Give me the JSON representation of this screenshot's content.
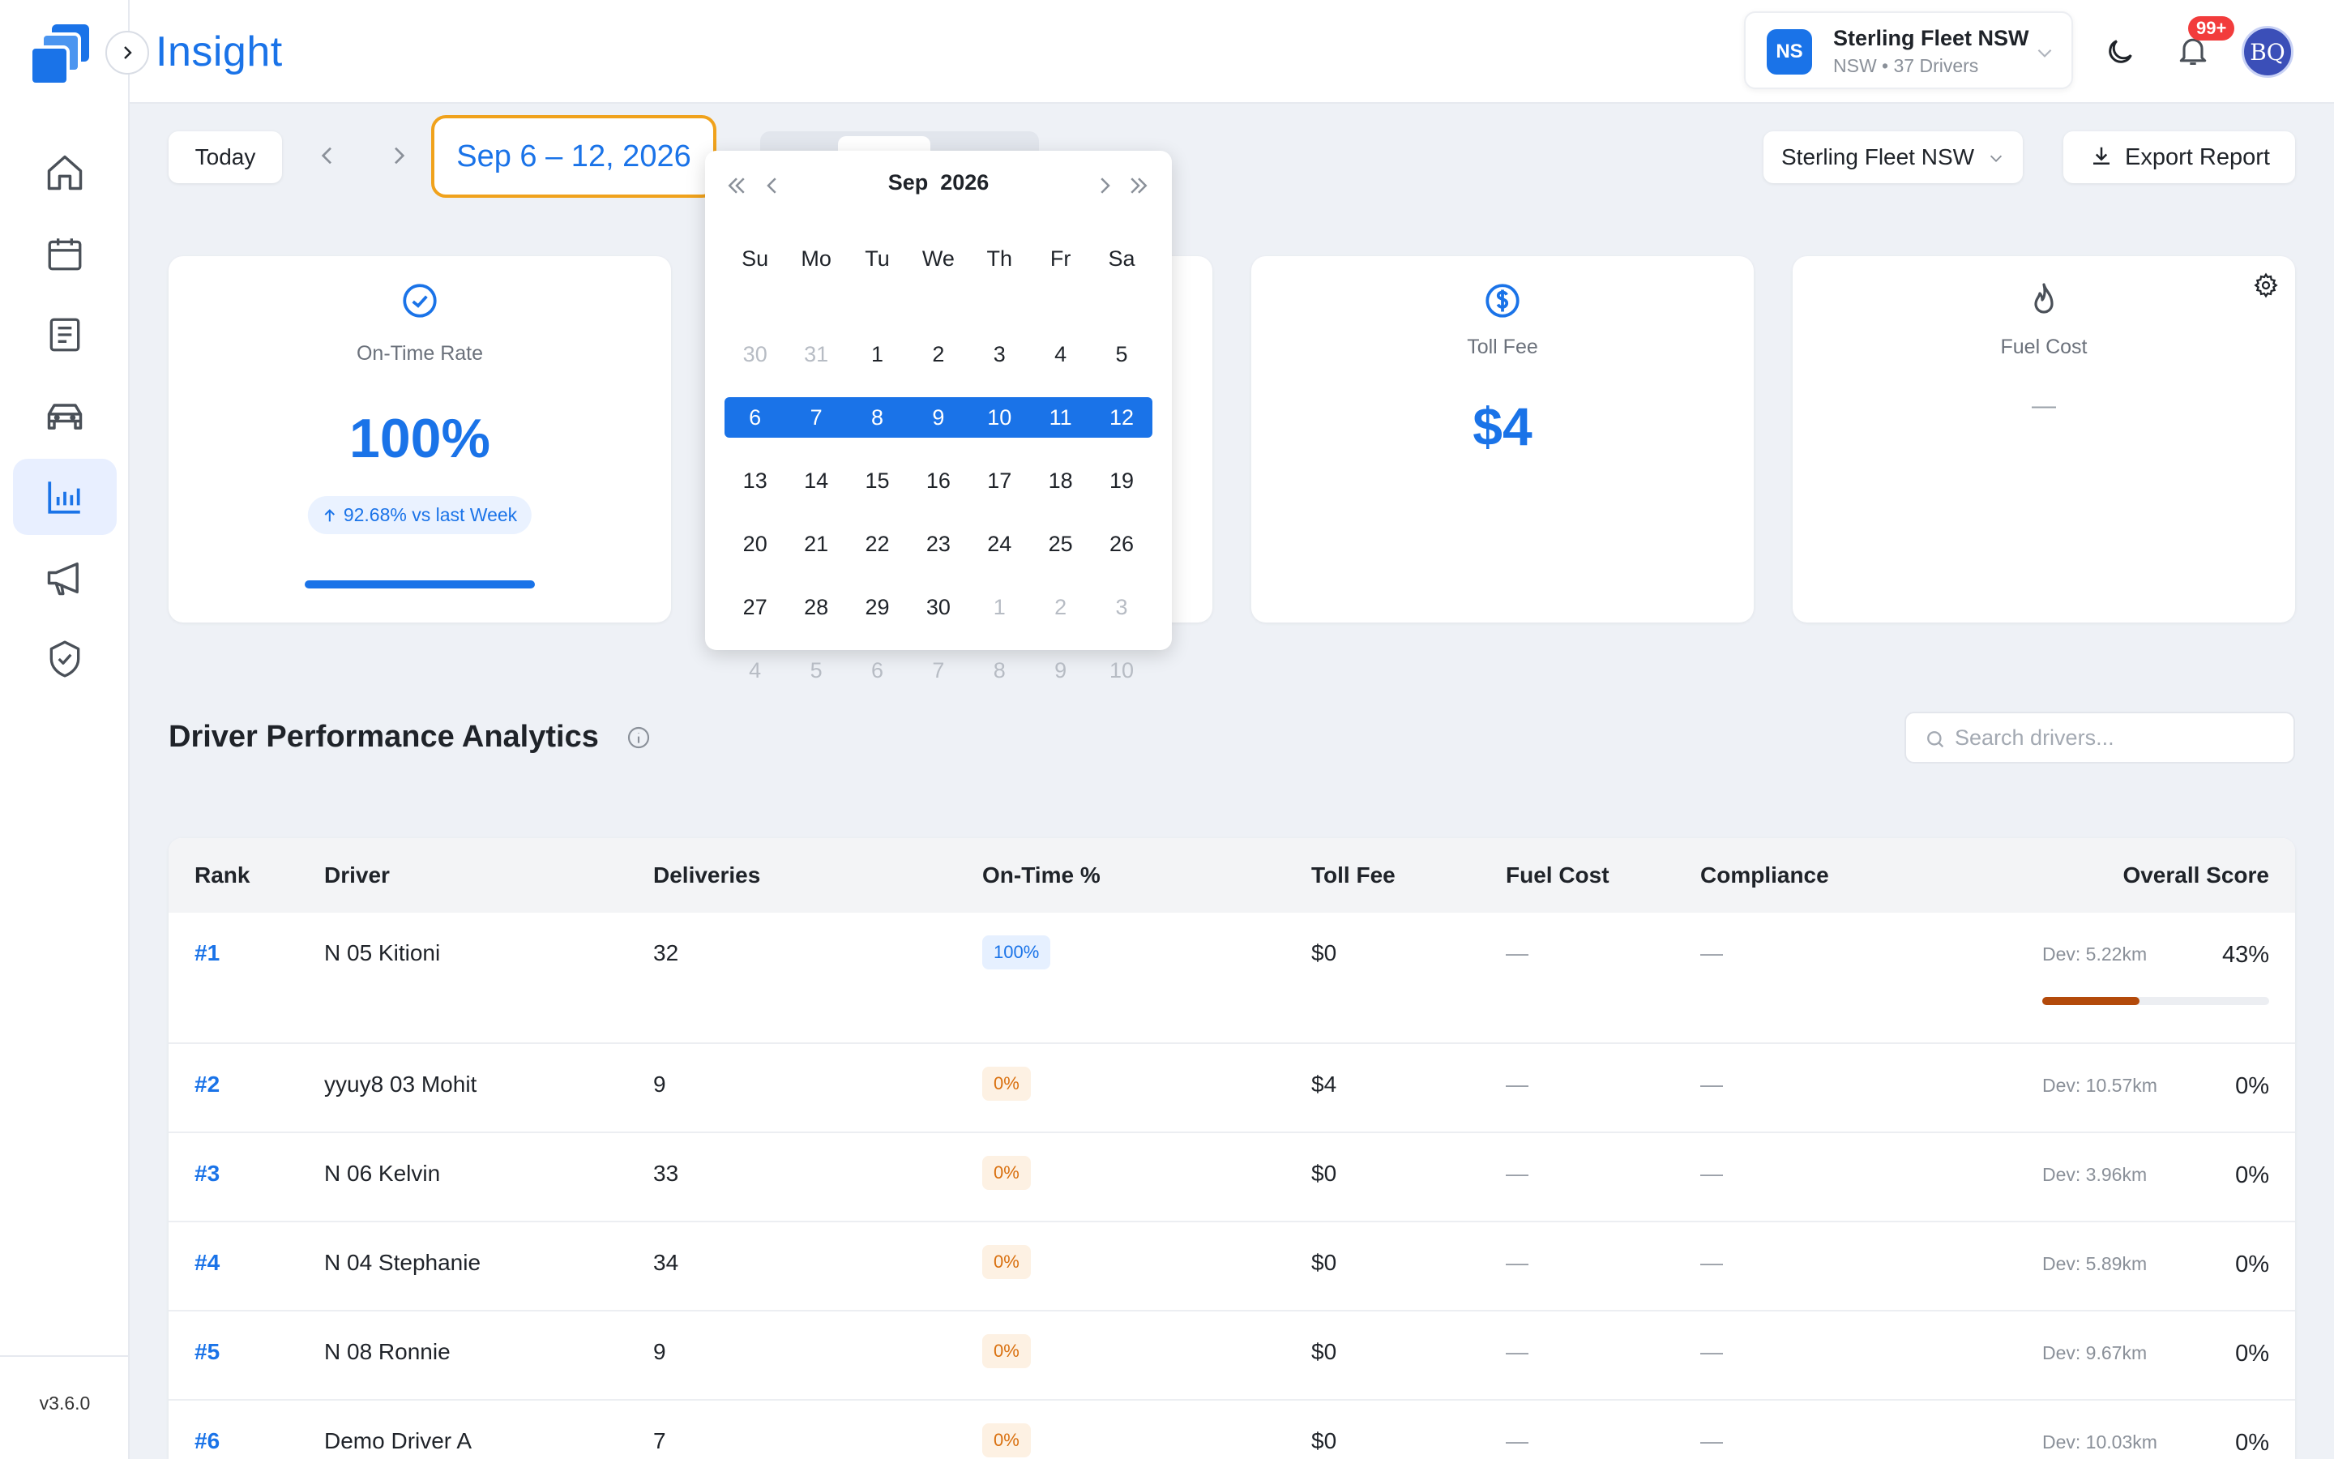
{
  "app": {
    "title": "Insight",
    "version": "v3.6.0"
  },
  "sidebar": {
    "items": [
      {
        "name": "home",
        "icon": "home-icon"
      },
      {
        "name": "calendar",
        "icon": "calendar-icon"
      },
      {
        "name": "reports",
        "icon": "document-icon"
      },
      {
        "name": "vehicles",
        "icon": "car-icon"
      },
      {
        "name": "analytics",
        "icon": "bar-chart-icon",
        "active": true
      },
      {
        "name": "announcements",
        "icon": "megaphone-icon"
      },
      {
        "name": "compliance",
        "icon": "shield-check-icon"
      }
    ]
  },
  "header": {
    "fleet": {
      "initials": "NS",
      "name": "Sterling Fleet NSW",
      "subtitle": "NSW • 37 Drivers"
    },
    "notifications_badge": "99+",
    "user_initials": "BQ"
  },
  "toolbar": {
    "today_label": "Today",
    "date_range": "Sep 6 – 12, 2026",
    "fleet_select": "Sterling Fleet NSW",
    "export_label": "Export Report"
  },
  "kpis": {
    "on_time": {
      "label": "On-Time Rate",
      "value": "100%",
      "trend": "92.68% vs last Week",
      "progress": 1.0
    },
    "toll": {
      "label": "Toll Fee",
      "value": "$4"
    },
    "fuel": {
      "label": "Fuel Cost",
      "value": "—"
    }
  },
  "calendar": {
    "month": "Sep",
    "year": "2026",
    "weekdays": [
      "Su",
      "Mo",
      "Tu",
      "We",
      "Th",
      "Fr",
      "Sa"
    ],
    "weeks": [
      [
        {
          "d": "30",
          "m": true
        },
        {
          "d": "31",
          "m": true
        },
        {
          "d": "1"
        },
        {
          "d": "2"
        },
        {
          "d": "3"
        },
        {
          "d": "4"
        },
        {
          "d": "5"
        }
      ],
      [
        {
          "d": "6"
        },
        {
          "d": "7"
        },
        {
          "d": "8"
        },
        {
          "d": "9"
        },
        {
          "d": "10"
        },
        {
          "d": "11"
        },
        {
          "d": "12"
        }
      ],
      [
        {
          "d": "13"
        },
        {
          "d": "14"
        },
        {
          "d": "15"
        },
        {
          "d": "16"
        },
        {
          "d": "17"
        },
        {
          "d": "18"
        },
        {
          "d": "19"
        }
      ],
      [
        {
          "d": "20"
        },
        {
          "d": "21"
        },
        {
          "d": "22"
        },
        {
          "d": "23"
        },
        {
          "d": "24"
        },
        {
          "d": "25"
        },
        {
          "d": "26"
        }
      ],
      [
        {
          "d": "27"
        },
        {
          "d": "28"
        },
        {
          "d": "29"
        },
        {
          "d": "30"
        },
        {
          "d": "1",
          "m": true
        },
        {
          "d": "2",
          "m": true
        },
        {
          "d": "3",
          "m": true
        }
      ],
      [
        {
          "d": "4",
          "m": true
        },
        {
          "d": "5",
          "m": true
        },
        {
          "d": "6",
          "m": true
        },
        {
          "d": "7",
          "m": true
        },
        {
          "d": "8",
          "m": true
        },
        {
          "d": "9",
          "m": true
        },
        {
          "d": "10",
          "m": true
        }
      ]
    ],
    "selected_week_index": 1
  },
  "section": {
    "title": "Driver Performance Analytics",
    "search_placeholder": "Search drivers..."
  },
  "table": {
    "columns": [
      "Rank",
      "Driver",
      "Deliveries",
      "On-Time %",
      "Toll Fee",
      "Fuel Cost",
      "Compliance",
      "Overall Score"
    ],
    "rows": [
      {
        "rank": "#1",
        "driver": "N 05 Kitioni",
        "deliveries": "32",
        "ontime": "100%",
        "ontime_tone": "blue",
        "toll": "$0",
        "fuel": "—",
        "compliance": "—",
        "dev": "Dev: 5.22km",
        "score": "43%",
        "score_value": 0.43
      },
      {
        "rank": "#2",
        "driver": "yyuy8 03 Mohit",
        "deliveries": "9",
        "ontime": "0%",
        "ontime_tone": "orange",
        "toll": "$4",
        "fuel": "—",
        "compliance": "—",
        "dev": "Dev: 10.57km",
        "score": "0%"
      },
      {
        "rank": "#3",
        "driver": "N 06 Kelvin",
        "deliveries": "33",
        "ontime": "0%",
        "ontime_tone": "orange",
        "toll": "$0",
        "fuel": "—",
        "compliance": "—",
        "dev": "Dev: 3.96km",
        "score": "0%"
      },
      {
        "rank": "#4",
        "driver": "N 04 Stephanie",
        "deliveries": "34",
        "ontime": "0%",
        "ontime_tone": "orange",
        "toll": "$0",
        "fuel": "—",
        "compliance": "—",
        "dev": "Dev: 5.89km",
        "score": "0%"
      },
      {
        "rank": "#5",
        "driver": "N 08 Ronnie",
        "deliveries": "9",
        "ontime": "0%",
        "ontime_tone": "orange",
        "toll": "$0",
        "fuel": "—",
        "compliance": "—",
        "dev": "Dev: 9.67km",
        "score": "0%"
      },
      {
        "rank": "#6",
        "driver": "Demo Driver A",
        "deliveries": "7",
        "ontime": "0%",
        "ontime_tone": "orange",
        "toll": "$0",
        "fuel": "—",
        "compliance": "—",
        "dev": "Dev: 10.03km",
        "score": "0%"
      }
    ]
  },
  "colors": {
    "accent": "#1a73e8",
    "highlight": "#f0a21c",
    "score_fill": "#b34a0b",
    "badge": "#f23c3c"
  }
}
